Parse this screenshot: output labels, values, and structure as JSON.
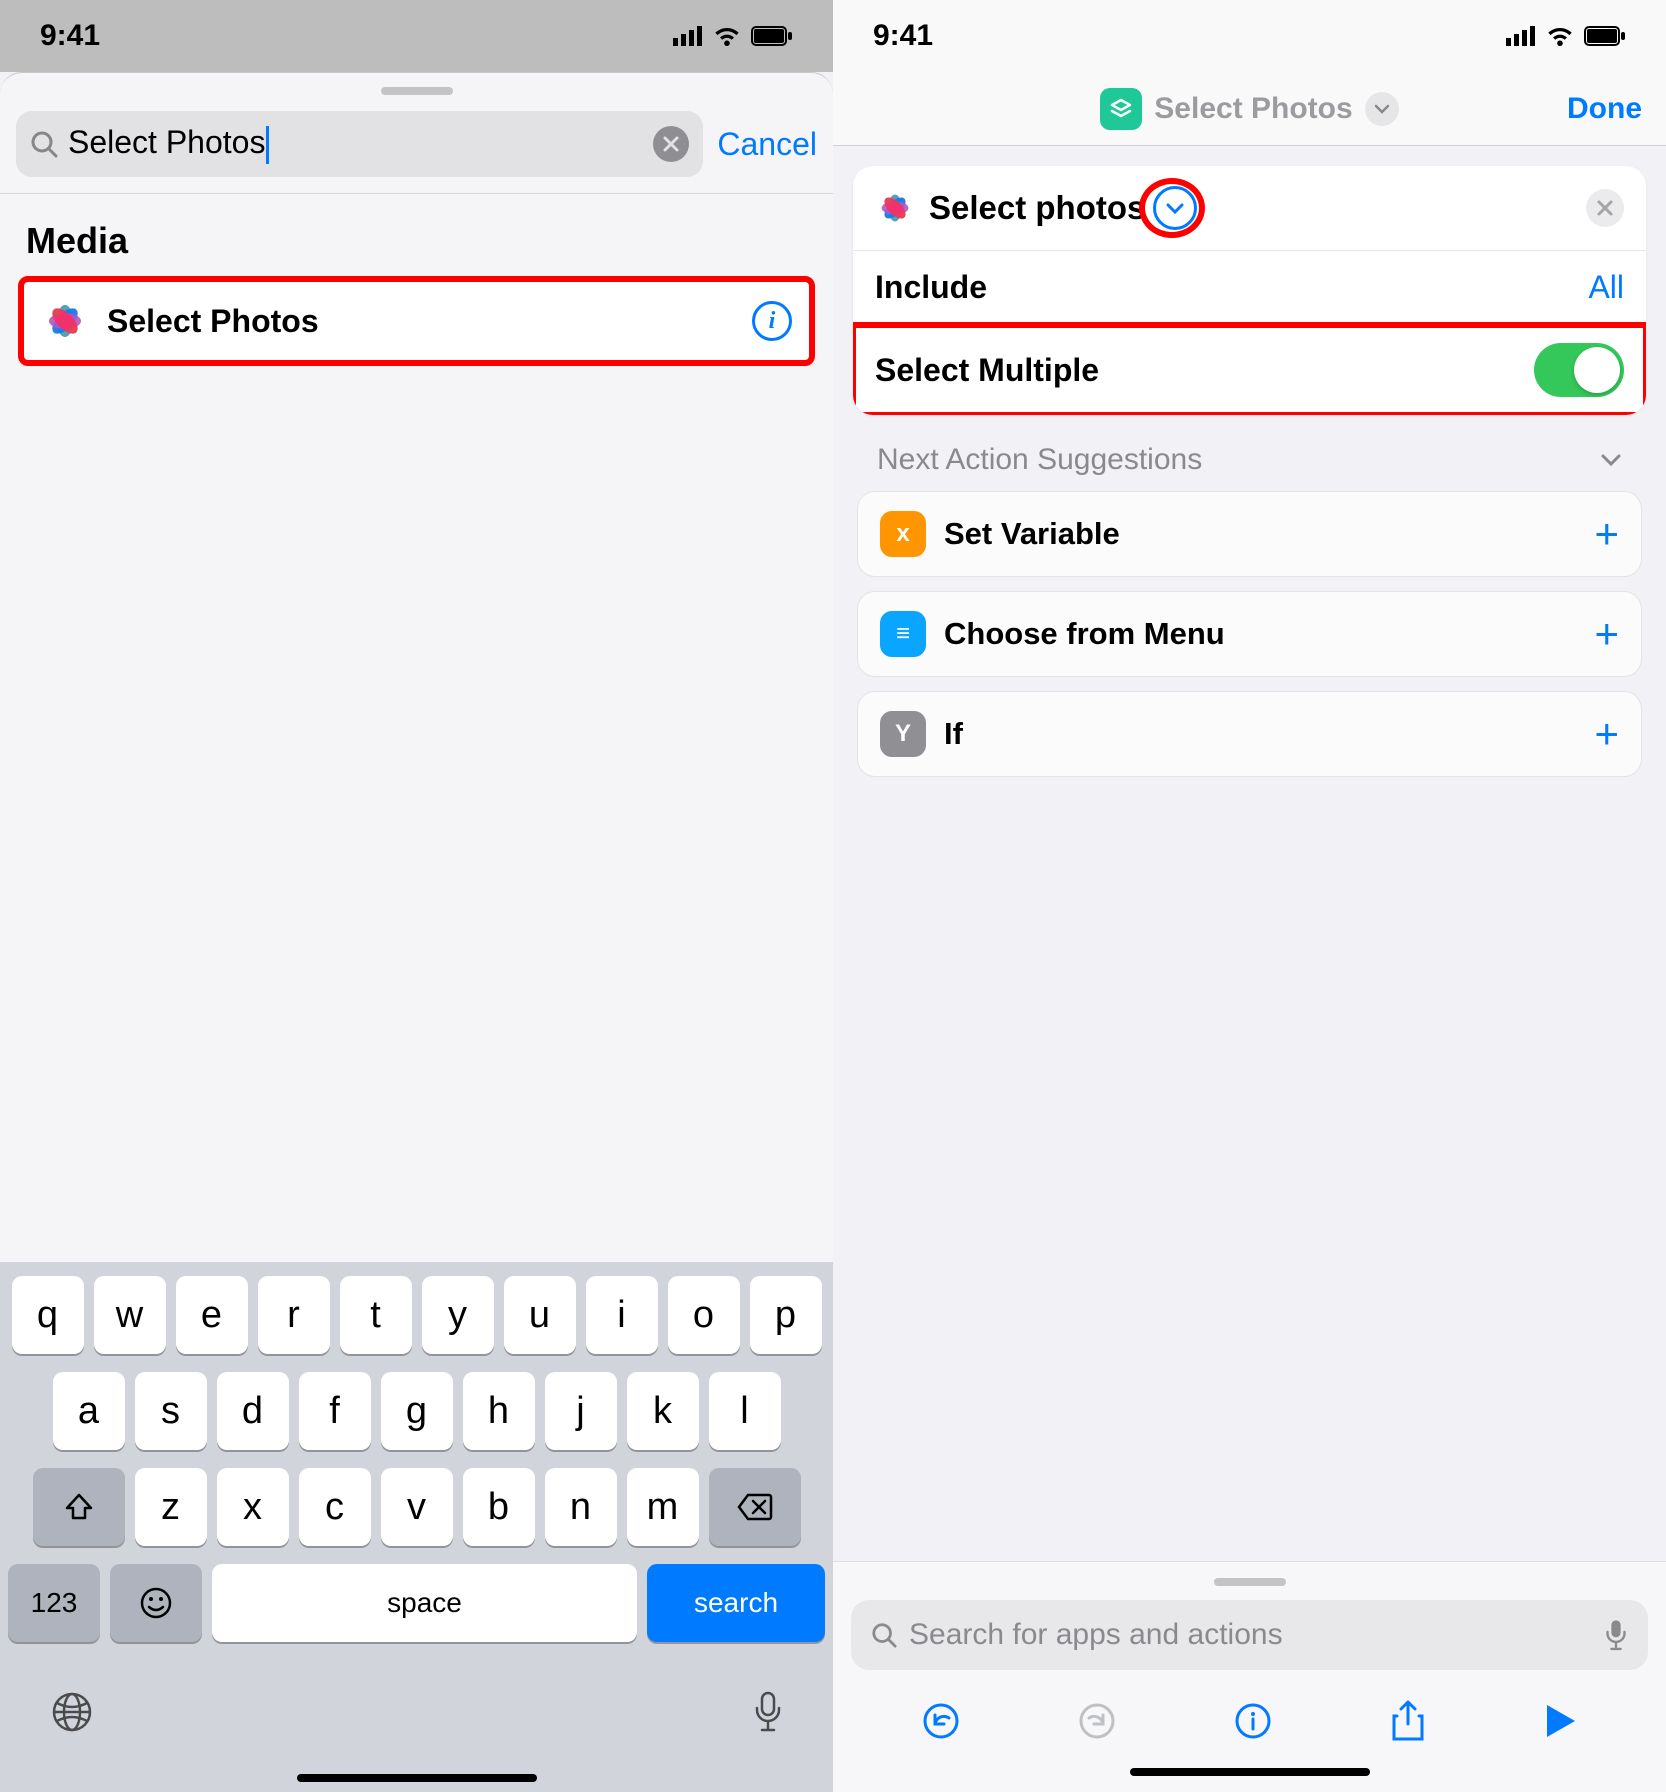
{
  "status": {
    "time": "9:41"
  },
  "left": {
    "search_value": "Select Photos",
    "cancel_label": "Cancel",
    "section_title": "Media",
    "result_label": "Select Photos",
    "keyboard": {
      "row1": [
        "q",
        "w",
        "e",
        "r",
        "t",
        "y",
        "u",
        "i",
        "o",
        "p"
      ],
      "row2": [
        "a",
        "s",
        "d",
        "f",
        "g",
        "h",
        "j",
        "k",
        "l"
      ],
      "row3": [
        "z",
        "x",
        "c",
        "v",
        "b",
        "n",
        "m"
      ],
      "k123": "123",
      "space": "space",
      "search": "search"
    }
  },
  "right": {
    "nav_title": "Select Photos",
    "done_label": "Done",
    "card_title": "Select photos",
    "include_label": "Include",
    "include_value": "All",
    "multi_label": "Select Multiple",
    "sugg_title": "Next Action Suggestions",
    "suggestions": [
      {
        "label": "Set Variable",
        "color": "#ff9500",
        "glyph": "x"
      },
      {
        "label": "Choose from Menu",
        "color": "#0aa5ff",
        "glyph": "≡"
      },
      {
        "label": "If",
        "color": "#8f8f94",
        "glyph": "Y"
      }
    ],
    "bottom_search_placeholder": "Search for apps and actions"
  }
}
